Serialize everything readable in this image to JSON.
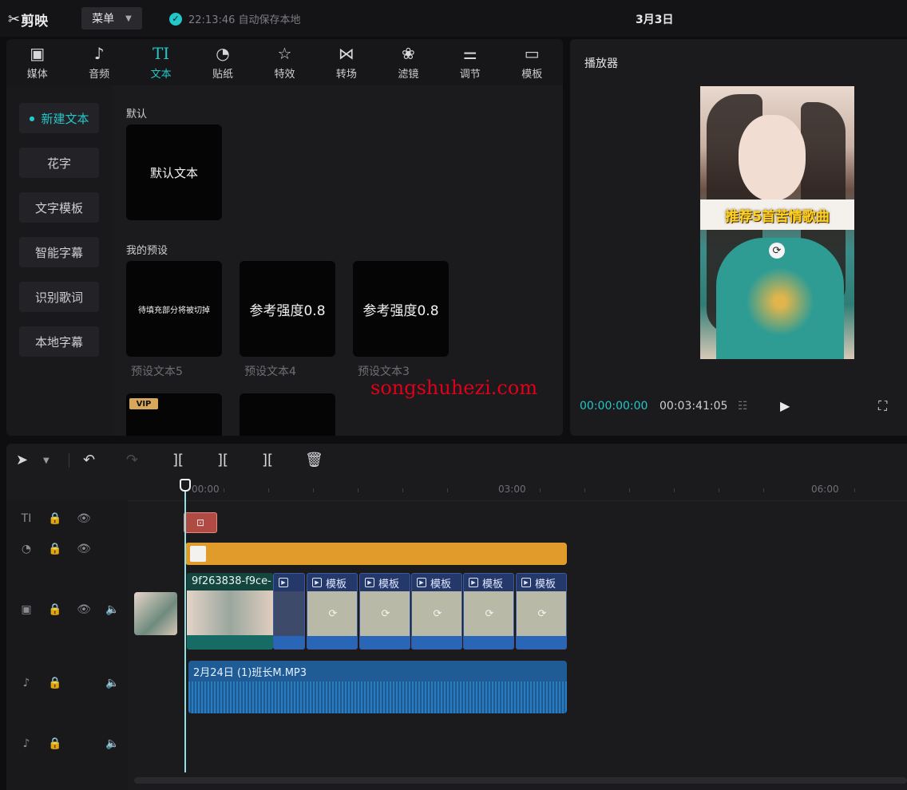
{
  "topbar": {
    "logo_text": "剪映",
    "menu_label": "菜单",
    "save_status": "22:13:46 自动保存本地",
    "project_title": "3月3日"
  },
  "tabs": [
    {
      "label": "媒体",
      "icon": "media-icon"
    },
    {
      "label": "音频",
      "icon": "audio-icon"
    },
    {
      "label": "文本",
      "icon": "text-icon",
      "active": true
    },
    {
      "label": "贴纸",
      "icon": "sticker-icon"
    },
    {
      "label": "特效",
      "icon": "effects-icon"
    },
    {
      "label": "转场",
      "icon": "transition-icon"
    },
    {
      "label": "滤镜",
      "icon": "filter-icon"
    },
    {
      "label": "调节",
      "icon": "adjust-icon"
    },
    {
      "label": "模板",
      "icon": "template-icon"
    }
  ],
  "categories": [
    "新建文本",
    "花字",
    "文字模板",
    "智能字幕",
    "识别歌词",
    "本地字幕"
  ],
  "text_panel": {
    "default_section": "默认",
    "default_card": "默认文本",
    "presets_section": "我的预设",
    "presets": [
      {
        "card_text": "待填充部分将被切掉",
        "caption": "预设文本5"
      },
      {
        "card_text": "参考强度0.8",
        "caption": "预设文本4"
      },
      {
        "card_text": "参考强度0.8",
        "caption": "预设文本3"
      }
    ],
    "vip_badge": "VIP"
  },
  "player": {
    "title": "播放器",
    "caption": "推荐5首苦情歌曲",
    "time_current": "00:00:00:00",
    "time_total": "00:03:41:05"
  },
  "watermark": "songshuhezi.com",
  "ruler": {
    "labels": [
      "00:00",
      "03:00",
      "06:00"
    ]
  },
  "timeline": {
    "main_clip_name": "9f263838-f9ce-",
    "template_label": "模板",
    "audio_clip_name": "2月24日 (1)班长M.MP3"
  },
  "colors": {
    "accent": "#22c7c8",
    "sticker_clip": "#e09b2b",
    "text_clip": "#b04b43",
    "audio_clip": "#1f5c96",
    "watermark": "#e0001a"
  }
}
